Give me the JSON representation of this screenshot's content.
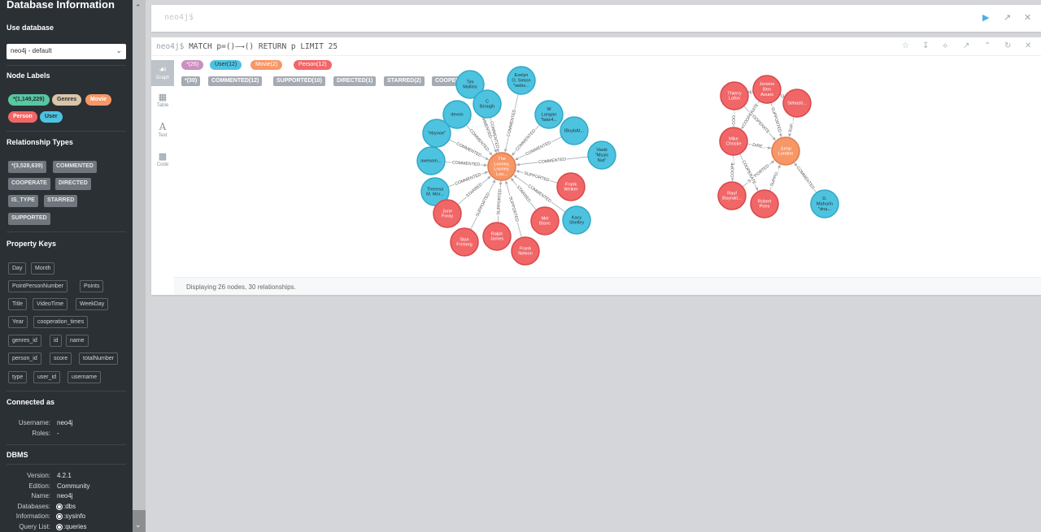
{
  "sidebar": {
    "title": "Database Information",
    "use_database_heading": "Use database",
    "db_selected": "neo4j - default",
    "node_labels_heading": "Node Labels",
    "node_labels": [
      {
        "label": "*(1,149,229)",
        "color": "#57c7a1",
        "text_color": "#2b3035"
      },
      {
        "label": "Genres",
        "color": "#d8c6a9",
        "text_color": "#2b3035"
      },
      {
        "label": "Movie",
        "color": "#f79767",
        "text_color": "#ffffff"
      },
      {
        "label": "Person",
        "color": "#f16667",
        "text_color": "#ffffff"
      },
      {
        "label": "User",
        "color": "#4dc3e0",
        "text_color": "#2b3035"
      }
    ],
    "rel_types_heading": "Relationship Types",
    "rel_types": [
      "*(3,528,639)",
      "COMMENTED",
      "COOPERATE",
      "DIRECTED",
      "IS_TYPE",
      "STARRED",
      "SUPPORTED"
    ],
    "property_keys_heading": "Property Keys",
    "property_keys": [
      "Day",
      "Month",
      "PointPersonNumber",
      "Points",
      "Title",
      "VideoTime",
      "WeekDay",
      "Year",
      "cooperation_times",
      "genres_id",
      "id",
      "name",
      "person_id",
      "score",
      "totalNumber",
      "type",
      "user_id",
      "username"
    ],
    "connected_heading": "Connected as",
    "connected": [
      {
        "key": "Username:",
        "value": "neo4j"
      },
      {
        "key": "Roles:",
        "value": "-"
      }
    ],
    "dbms_heading": "DBMS",
    "dbms": [
      {
        "key": "Version:",
        "value": "4.2.1"
      },
      {
        "key": "Edition:",
        "value": "Community"
      },
      {
        "key": "Name:",
        "value": "neo4j"
      },
      {
        "key": "Databases:",
        "value": ":dbs"
      },
      {
        "key": "Information:",
        "value": ":sysinfo"
      },
      {
        "key": "Query List:",
        "value": ":queries"
      }
    ]
  },
  "editor": {
    "prompt": "neo4j$",
    "icons": [
      "play-icon",
      "expand-icon",
      "close-icon"
    ]
  },
  "frame": {
    "prompt": "neo4j$",
    "query": "MATCH p=()→() RETURN p LIMIT 25",
    "query_display": "MATCH p=()—→() RETURN p LIMIT 25",
    "views": [
      {
        "label": "Graph",
        "icon": "graph-icon",
        "active": true
      },
      {
        "label": "Table",
        "icon": "table-icon",
        "active": false
      },
      {
        "label": "Text",
        "icon": "text-icon",
        "active": false
      },
      {
        "label": "Code",
        "icon": "code-icon",
        "active": false
      }
    ],
    "node_legend": [
      {
        "label": "*(26)",
        "color": "#c990c0",
        "text_color": "#ffffff"
      },
      {
        "label": "User(12)",
        "color": "#4dc3e0",
        "text_color": "#2b3035"
      },
      {
        "label": "Movie(2)",
        "color": "#f79767",
        "text_color": "#ffffff"
      },
      {
        "label": "Person(12)",
        "color": "#f16667",
        "text_color": "#ffffff"
      }
    ],
    "rel_legend": [
      "*(30)",
      "COMMENTED(12)",
      "SUPPORTED(10)",
      "DIRECTED(1)",
      "STARRED(2)",
      "COOPERATE(5)"
    ],
    "status": "Displaying 26 nodes, 30 relationships."
  },
  "colors": {
    "user": "#4dc3e0",
    "user_stroke": "#2fa9c8",
    "person": "#f16667",
    "person_stroke": "#d9484a",
    "movie": "#f79767",
    "movie_stroke": "#e07b49",
    "edge": "#a5abb6"
  },
  "graph": {
    "nodes": [
      {
        "id": "m1",
        "type": "movie",
        "lines": [
          "The",
          "Looney,",
          "Looney,",
          "Loo..."
        ]
      },
      {
        "id": "u1",
        "type": "user",
        "lines": [
          "Tim",
          "Mullins"
        ]
      },
      {
        "id": "u2",
        "type": "user",
        "lines": [
          "Evelyn",
          "O. Simon",
          "\"webs..."
        ]
      },
      {
        "id": "u3",
        "type": "user",
        "lines": [
          "C",
          "Brough"
        ]
      },
      {
        "id": "u4",
        "type": "user",
        "lines": [
          "W",
          "Langan",
          "\"fake4..."
        ]
      },
      {
        "id": "u5",
        "type": "user",
        "lines": [
          "devon"
        ]
      },
      {
        "id": "u6",
        "type": "user",
        "lines": [
          "IBuybAt..."
        ]
      },
      {
        "id": "u7",
        "type": "user",
        "lines": [
          "\"ebynoe\""
        ]
      },
      {
        "id": "u8",
        "type": "user",
        "lines": [
          "Vaski",
          "\"Music",
          "Nut\""
        ]
      },
      {
        "id": "u9",
        "type": "user",
        "lines": [
          "awesom..."
        ]
      },
      {
        "id": "u10",
        "type": "user",
        "lines": [
          "Theresa",
          "M. Mor..."
        ]
      },
      {
        "id": "u11",
        "type": "user",
        "lines": [
          "Kacy",
          "Shelley"
        ]
      },
      {
        "id": "p1",
        "type": "person",
        "lines": [
          "Frank",
          "Welker"
        ]
      },
      {
        "id": "p2",
        "type": "person",
        "lines": [
          "June",
          "Foray"
        ]
      },
      {
        "id": "p3",
        "type": "person",
        "lines": [
          "Mel",
          "Blanc"
        ]
      },
      {
        "id": "p4",
        "type": "person",
        "lines": [
          "Stan",
          "Freberg"
        ]
      },
      {
        "id": "p5",
        "type": "person",
        "lines": [
          "Ralph",
          "James"
        ]
      },
      {
        "id": "p6",
        "type": "person",
        "lines": [
          "Frank",
          "Nelson"
        ]
      },
      {
        "id": "m2",
        "type": "movie",
        "lines": [
          "Jump",
          "London"
        ]
      },
      {
        "id": "p7",
        "type": "person",
        "lines": [
          "Thierry",
          "Lafon"
        ]
      },
      {
        "id": "p8",
        "type": "person",
        "lines": [
          "Jerome",
          "Ben",
          "Aoues"
        ]
      },
      {
        "id": "p9",
        "type": "person",
        "lines": [
          "Sebasti..."
        ]
      },
      {
        "id": "p10",
        "type": "person",
        "lines": [
          "Mike",
          "Christie"
        ]
      },
      {
        "id": "p11",
        "type": "person",
        "lines": [
          "Rauf",
          "Bayrakt..."
        ]
      },
      {
        "id": "p12",
        "type": "person",
        "lines": [
          "Robert",
          "Pires"
        ]
      },
      {
        "id": "u12",
        "type": "user",
        "lines": [
          "D.",
          "Mahurin",
          "\"dna..."
        ]
      }
    ],
    "edges": [
      {
        "from": "u1",
        "to": "m1",
        "label": "COMMENTED"
      },
      {
        "from": "u2",
        "to": "m1",
        "label": "COMMENTED"
      },
      {
        "from": "u3",
        "to": "m1",
        "label": "COMMENTED"
      },
      {
        "from": "u4",
        "to": "m1",
        "label": "COMMENTED"
      },
      {
        "from": "u5",
        "to": "m1",
        "label": "COMMENTED"
      },
      {
        "from": "u6",
        "to": "m1",
        "label": "COMMENTED"
      },
      {
        "from": "u7",
        "to": "m1",
        "label": "COMMENTED"
      },
      {
        "from": "u8",
        "to": "m1",
        "label": "COMMENTED"
      },
      {
        "from": "u9",
        "to": "m1",
        "label": "COMMENTED"
      },
      {
        "from": "u10",
        "to": "m1",
        "label": "COMMENTED"
      },
      {
        "from": "u11",
        "to": "m1",
        "label": "COMMENTED"
      },
      {
        "from": "p1",
        "to": "m1",
        "label": "SUPPORTED"
      },
      {
        "from": "p2",
        "to": "m1",
        "label": "STARRED"
      },
      {
        "from": "p3",
        "to": "m1",
        "label": "STARRED"
      },
      {
        "from": "p4",
        "to": "m1",
        "label": "SUPPORTED"
      },
      {
        "from": "p5",
        "to": "m1",
        "label": "SUPPORTED"
      },
      {
        "from": "p6",
        "to": "m1",
        "label": "SUPPORTED"
      },
      {
        "from": "p7",
        "to": "m2",
        "label": "COOPERATE"
      },
      {
        "from": "p8",
        "to": "m2",
        "label": "SUPPORTED"
      },
      {
        "from": "p9",
        "to": "m2",
        "label": "SUP..."
      },
      {
        "from": "p10",
        "to": "m2",
        "label": "DIRE..."
      },
      {
        "from": "p11",
        "to": "m2",
        "label": "SUPPORTED"
      },
      {
        "from": "p12",
        "to": "m2",
        "label": "SUPPO..."
      },
      {
        "from": "u12",
        "to": "m2",
        "label": "COMMENTED"
      },
      {
        "from": "p7",
        "to": "p10",
        "label": "COO..."
      },
      {
        "from": "p8",
        "to": "p10",
        "label": "COOPERATE"
      },
      {
        "from": "p10",
        "to": "p11",
        "label": "COOPE..."
      },
      {
        "from": "p10",
        "to": "p12",
        "label": "COOPERATE"
      },
      {
        "from": "p7",
        "to": "p8",
        "label": "COOPERATE"
      },
      {
        "from": "p9",
        "to": "p8",
        "label": "SUPPORTED"
      }
    ]
  }
}
